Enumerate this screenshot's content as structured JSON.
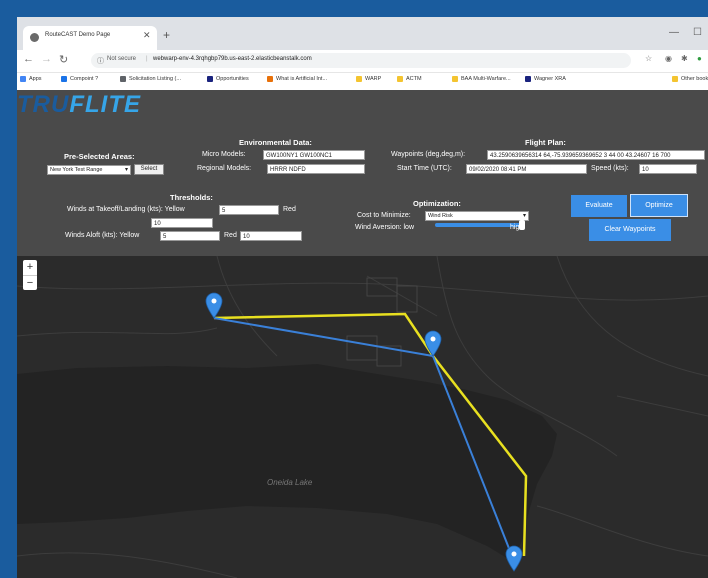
{
  "browser": {
    "tab_title": "RouteCAST Demo Page",
    "url": "webwarp-env-4.3rqhgbp79b.us-east-2.elasticbeanstalk.com",
    "security_label": "Not secure",
    "bookmarks": [
      {
        "label": "Apps",
        "color": "#4285f4"
      },
      {
        "label": "Compoint ?",
        "color": "#1a73e8"
      },
      {
        "label": "Solicitation Listing (...",
        "color": "#5f6368"
      },
      {
        "label": "Opportunities",
        "color": "#1a237e"
      },
      {
        "label": "What is Artificial Int...",
        "color": "#e8710a"
      },
      {
        "label": "WARP",
        "color": "#f4c430"
      },
      {
        "label": "ACTM",
        "color": "#f4c430"
      },
      {
        "label": "BAA Multi-Warfare...",
        "color": "#f4c430"
      },
      {
        "label": "Wagner XRA",
        "color": "#1a237e"
      },
      {
        "label": "Other book",
        "color": "#f4c430"
      }
    ]
  },
  "logo": {
    "part1": "TRU",
    "part2": "FLITE"
  },
  "preselected": {
    "heading": "Pre-Selected Areas:",
    "area_value": "New York Test Range",
    "select_label": "Select"
  },
  "environment": {
    "heading": "Environmental Data:",
    "micro_label": "Micro Models:",
    "micro_value": "GW100NY1 GW100NC1",
    "regional_label": "Regional Models:",
    "regional_value": "HRRR NDFD"
  },
  "flight_plan": {
    "heading": "Flight Plan:",
    "waypoints_label": "Waypoints (deg,deg,m):",
    "waypoints_value": "43.2590639656314 64,-75.939659369652 3 44 00 43.24607 16 700",
    "start_label": "Start Time (UTC):",
    "start_value": "09/02/2020 08:41 PM",
    "speed_label": "Speed (kts):",
    "speed_value": "10"
  },
  "thresholds": {
    "heading": "Thresholds:",
    "takeoff_label": "Winds at Takeoff/Landing (kts): Yellow",
    "takeoff_yellow": "5",
    "takeoff_red_label": "Red",
    "takeoff_red": "10",
    "aloft_label": "Winds Aloft (kts): Yellow",
    "aloft_yellow": "5",
    "aloft_red_label": "Red",
    "aloft_red": "10"
  },
  "optimization": {
    "heading": "Optimization:",
    "cost_label": "Cost to Minimize:",
    "cost_value": "Wind Risk",
    "aversion_label": "Wind Aversion: low",
    "aversion_high": "high",
    "aversion_level": 0.95
  },
  "actions": {
    "evaluate": "Evaluate",
    "optimize": "Optimize",
    "clear": "Clear Waypoints"
  },
  "map": {
    "lake_label": "Oneida Lake",
    "route_colors": {
      "original": "#e8e020",
      "optimized": "#3a80d8",
      "marker": "#3a8ee6"
    }
  }
}
